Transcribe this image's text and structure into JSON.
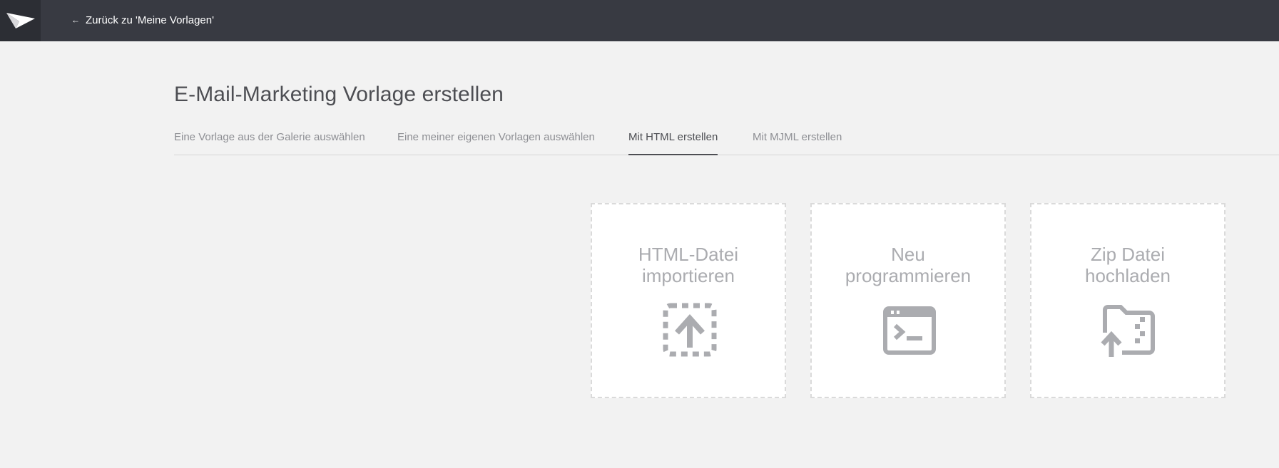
{
  "header": {
    "logo_icon": "paper-plane-icon",
    "back_arrow_icon": "arrow-left-icon",
    "back_label": "Zurück zu 'Meine Vorlagen'",
    "background": "#383a42"
  },
  "page": {
    "title": "E-Mail-Marketing Vorlage erstellen"
  },
  "tabs": [
    {
      "label": "Eine Vorlage aus der Galerie auswählen",
      "active": false
    },
    {
      "label": "Eine meiner eigenen Vorlagen auswählen",
      "active": false
    },
    {
      "label": "Mit HTML erstellen",
      "active": true
    },
    {
      "label": "Mit MJML erstellen",
      "active": false
    }
  ],
  "cards": [
    {
      "line1": "HTML-Datei",
      "line2": "importieren",
      "icon": "upload-dashed-box-icon"
    },
    {
      "line1": "Neu",
      "line2": "programmieren",
      "icon": "terminal-window-icon"
    },
    {
      "line1": "Zip Datei",
      "line2": "hochladen",
      "icon": "folder-zip-upload-icon"
    }
  ],
  "colors": {
    "accent": "#4d4e53",
    "muted": "#8d8e93",
    "icon": "#abacb0",
    "page_background": "#f2f2f2"
  }
}
